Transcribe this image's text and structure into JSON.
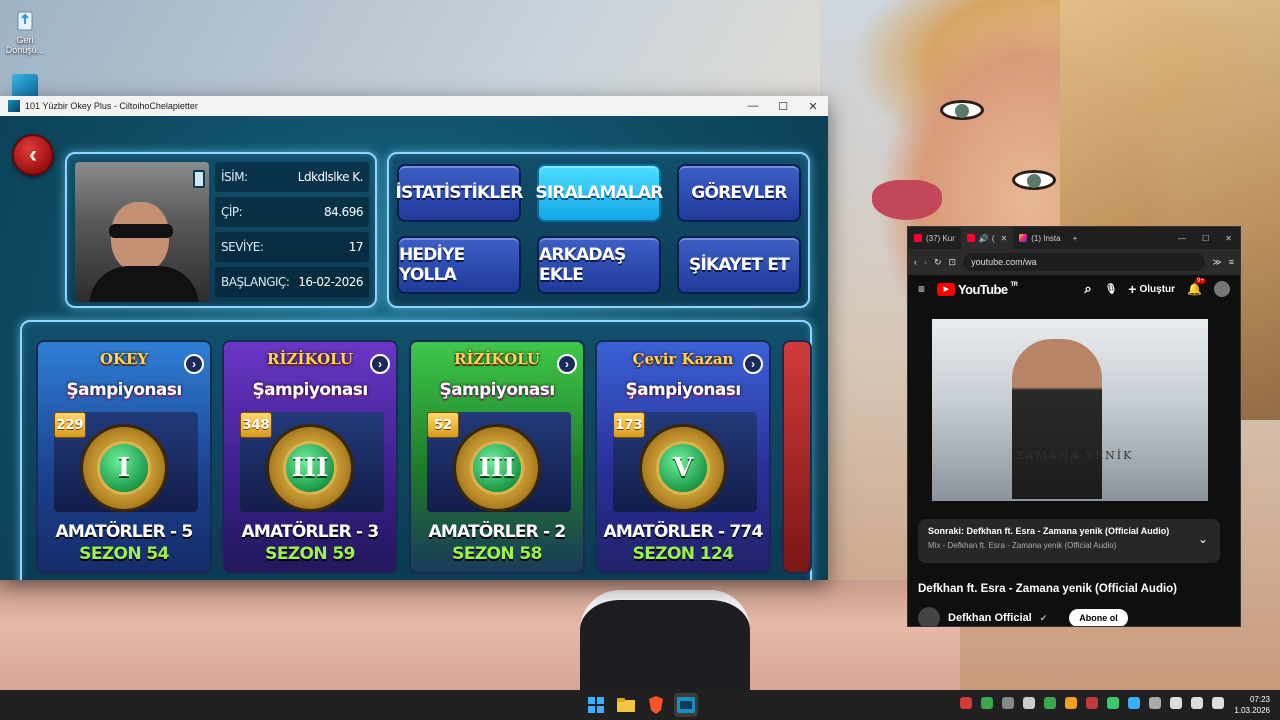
{
  "desktop": {
    "recycle_bin_label": "Geri\nDönüşü...",
    "colors": {
      "accent": "#0f4c63"
    }
  },
  "okey_window": {
    "title": "101 Yüzbir Okey Plus - CiltoihoChelapietter",
    "controls": {
      "minimize": "—",
      "maximize": "☐",
      "close": "✕"
    },
    "back_icon": "‹",
    "profile": {
      "rows": [
        {
          "label": "İSİM:",
          "value": "Ldkdlslke K."
        },
        {
          "label": "ÇİP:",
          "value": "84.696"
        },
        {
          "label": "SEVİYE:",
          "value": "17"
        },
        {
          "label": "BAŞLANGIÇ:",
          "value": "16-02-2026"
        }
      ]
    },
    "menu": [
      {
        "label": "İSTATİSTİKLER",
        "active": false
      },
      {
        "label": "SIRALAMALAR",
        "active": true
      },
      {
        "label": "GÖREVLER",
        "active": false
      },
      {
        "label": "HEDİYE YOLLA",
        "active": false
      },
      {
        "label": "ARKADAŞ EKLE",
        "active": false
      },
      {
        "label": "ŞİKAYET ET",
        "active": false
      }
    ],
    "tournaments": [
      {
        "brand": "OKEY",
        "title": "Şampiyonası",
        "count": "229",
        "rank": "I",
        "level": "AMATÖRLER - 5",
        "season": "SEZON 54"
      },
      {
        "brand": "RİZİKOLU",
        "title": "Şampiyonası",
        "count": "348",
        "rank": "III",
        "level": "AMATÖRLER - 3",
        "season": "SEZON 59"
      },
      {
        "brand": "RİZİKOLU",
        "title": "Şampiyonası",
        "count": "52",
        "rank": "III",
        "level": "AMATÖRLER - 2",
        "season": "SEZON 58"
      },
      {
        "brand": "Çevir Kazan",
        "title": "Şampiyonası",
        "count": "173",
        "rank": "V",
        "level": "AMATÖRLER - 774",
        "season": "SEZON 124"
      }
    ],
    "arrow_icon": "›"
  },
  "browser": {
    "tabs": [
      {
        "label": "(37) Kur"
      },
      {
        "label": "("
      },
      {
        "label": "(1) Insta"
      }
    ],
    "url": "youtube.com/wa",
    "youtube": {
      "logo": "YouTube",
      "region": "TR",
      "create_label": "Oluştur",
      "notifications": "9+",
      "video_caption": "ZAMANA YENİK",
      "next_label": "Sonraki: Defkhan ft. Esra - Zamana yenik (Official Audio)",
      "next_sub": "Mix - Defkhan ft. Esra - Zamana yenik (Official Audio)",
      "video_title": "Defkhan ft. Esra - Zamana yenik (Official Audio)",
      "channel": "Defkhan Official",
      "subscribe": "Abone ol"
    }
  },
  "taskbar": {
    "time": "07:23",
    "date": "1.03.2026"
  }
}
